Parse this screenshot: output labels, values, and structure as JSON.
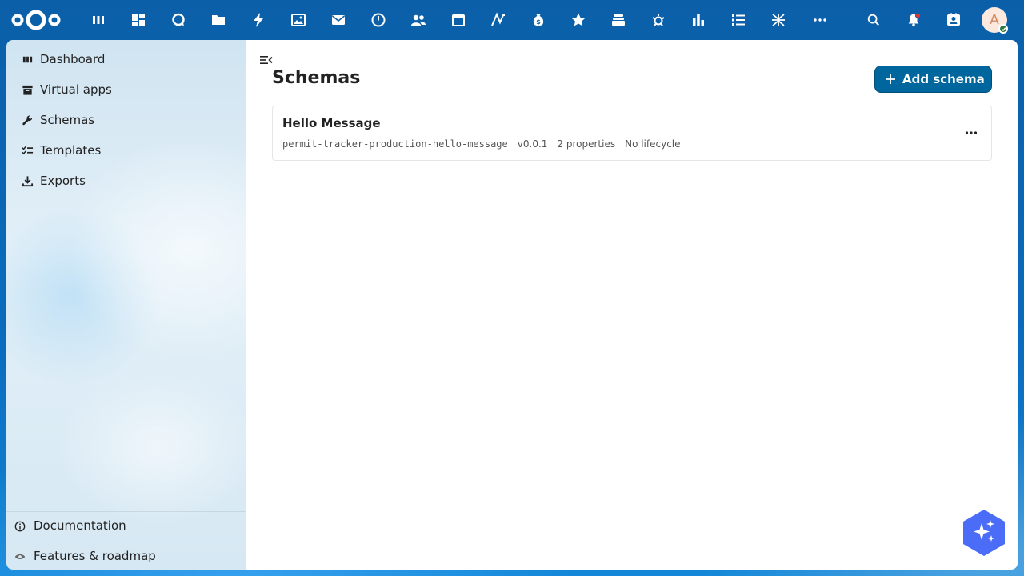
{
  "header": {
    "apps": [
      {
        "name": "dashboard-app-icon",
        "icon": "dashboard"
      },
      {
        "name": "apps-grid-icon",
        "icon": "grid"
      },
      {
        "name": "talk-icon",
        "icon": "chat"
      },
      {
        "name": "files-icon",
        "icon": "folder"
      },
      {
        "name": "activity-icon",
        "icon": "bolt"
      },
      {
        "name": "photos-icon",
        "icon": "image"
      },
      {
        "name": "mail-icon",
        "icon": "envelope"
      },
      {
        "name": "time-icon",
        "icon": "clock"
      },
      {
        "name": "contacts-icon",
        "icon": "people"
      },
      {
        "name": "calendar-icon",
        "icon": "calendar"
      },
      {
        "name": "notes-icon",
        "icon": "pen"
      },
      {
        "name": "money-icon",
        "icon": "moneybag"
      },
      {
        "name": "favorites-icon",
        "icon": "star"
      },
      {
        "name": "deck-icon",
        "icon": "stack"
      },
      {
        "name": "settings-app-icon",
        "icon": "gear-star"
      },
      {
        "name": "analytics-icon",
        "icon": "bar-chart"
      },
      {
        "name": "tasks-icon",
        "icon": "list"
      },
      {
        "name": "tool-app-icon",
        "icon": "tool"
      },
      {
        "name": "more-apps-icon",
        "icon": "ellipsis"
      }
    ],
    "avatar_initial": "A"
  },
  "sidebar": {
    "items": [
      {
        "label": "Dashboard",
        "icon": "dashboard-icon"
      },
      {
        "label": "Virtual apps",
        "icon": "archive-icon"
      },
      {
        "label": "Schemas",
        "icon": "wrench-icon"
      },
      {
        "label": "Templates",
        "icon": "checklist-icon"
      },
      {
        "label": "Exports",
        "icon": "download-icon"
      }
    ],
    "footer": [
      {
        "label": "Documentation",
        "icon": "info-icon"
      },
      {
        "label": "Features & roadmap",
        "icon": "eye-icon"
      }
    ]
  },
  "main": {
    "title": "Schemas",
    "add_button_label": "Add schema",
    "schemas": [
      {
        "title": "Hello Message",
        "slug": "permit-tracker-production-hello-message",
        "version": "v0.0.1",
        "properties": "2 properties",
        "lifecycle": "No lifecycle"
      }
    ]
  },
  "colors": {
    "header_bg": "#0b5fa8",
    "primary_button": "#00679e",
    "assistant_button": "#4a6cf7",
    "notification_dot": "#e9322d",
    "status_online": "#2d7b41"
  }
}
